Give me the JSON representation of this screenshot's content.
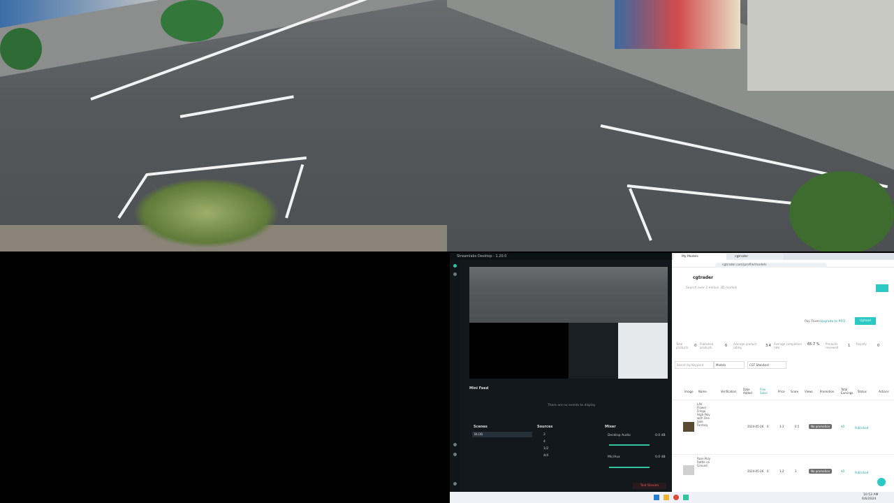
{
  "obs": {
    "title": "Streamlabs Desktop - 1.20.0",
    "mini_feed": "Mini Feed",
    "mini_feed_empty": "There are no events to display",
    "scenes_label": "Scenes",
    "scene_item": "BLOB",
    "sources_label": "Sources",
    "sources": [
      "2",
      "4",
      "1/2",
      "4/4"
    ],
    "mixer_label": "Mixer",
    "desktop_audio": "Desktop Audio",
    "desktop_audio_db": "0.0 dB",
    "mic_aux": "Mic/Aux",
    "mic_aux_db": "0.0 dB",
    "go_live": "Test Stream"
  },
  "browser": {
    "tab1": "My Models",
    "tab2": "cgtrader",
    "url": "cgtrader.com/profile/models",
    "brand": "cgtrader",
    "search_placeholder": "Search over 2 million 3D models",
    "pay_label": "Pay Taxes",
    "pay_link": "Upgrade to PRO",
    "upload": "Upload",
    "stats": [
      {
        "label": "Total products",
        "value": "0"
      },
      {
        "label": "Published products",
        "value": "0"
      },
      {
        "label": "Average product rating",
        "value": "3.4"
      },
      {
        "label": "Average completion rate",
        "value": "65.7 %"
      },
      {
        "label": "Products reviewed",
        "value": "1"
      },
      {
        "label": "Royalty",
        "value": "0"
      }
    ],
    "filter_search": "Search by Keyword",
    "filter_models": "Models",
    "filter_license": "CGT Standard",
    "headers": [
      "Image",
      "Name",
      "Verification",
      "Date Added",
      "Free Sales",
      "Price",
      "Score",
      "Views",
      "Promotion",
      "Total Earnings",
      "Status",
      "Actions"
    ],
    "rows": [
      {
        "name": "LAV Flower Fringe High Poly with One Sale Fantasy",
        "date": "2024-05-26",
        "sales": "0",
        "price": "3.3",
        "score": "0.5",
        "promotion": "No promotion",
        "earnings": "$0",
        "status": "Published"
      },
      {
        "name": "Rose Poly Rattle on Ground",
        "date": "2024-05-26",
        "sales": "0",
        "price": "1.2",
        "score": "3",
        "promotion": "No promotion",
        "earnings": "$0",
        "status": "Published"
      }
    ]
  },
  "taskbar": {
    "time": "10:53 AM",
    "date": "6/6/2024"
  }
}
